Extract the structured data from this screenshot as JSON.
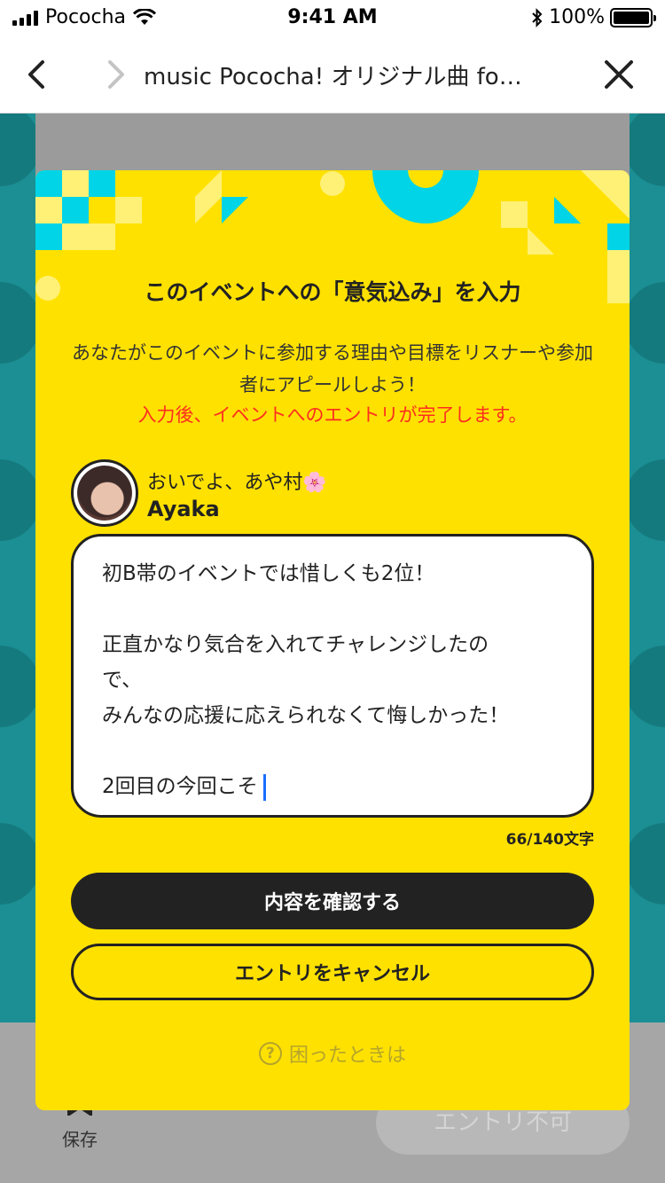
{
  "status_bar": {
    "carrier": "Pococha",
    "time": "9:41 AM",
    "battery": "100%"
  },
  "nav": {
    "title": "music Pococha! オリジナル曲 fo…",
    "back_icon": "chevron-left-icon",
    "forward_icon": "chevron-right-icon",
    "close_icon": "close-icon"
  },
  "background": {
    "save_label": "保存",
    "entry_disabled_label": "エントリ不可"
  },
  "modal": {
    "title": "このイベントへの「意気込み」を入力",
    "description": "あなたがこのイベントに参加する理由や目標をリスナーや参加者にアピールしよう！",
    "note": "入力後、イベントへのエントリが完了します。",
    "user": {
      "status": "おいでよ、あや村🌸",
      "name": "Ayaka"
    },
    "text_lines": [
      "初B帯のイベントでは惜しくも2位！",
      "",
      "正直かなり気合を入れてチャレンジしたの",
      "で、",
      "みんなの応援に応えられなくて悔しかった！",
      "",
      "2回目の今回こそ"
    ],
    "char_count": "66/140文字",
    "confirm_label": "内容を確認する",
    "cancel_label": "エントリをキャンセル",
    "help_label": "困ったときは",
    "help_icon": "question-circle-icon"
  },
  "colors": {
    "modal_bg": "#ffe100",
    "accent_cyan": "#00d4e6",
    "dark": "#222222",
    "note_red": "#ff2e1f",
    "background_teal": "#1b8f93"
  }
}
